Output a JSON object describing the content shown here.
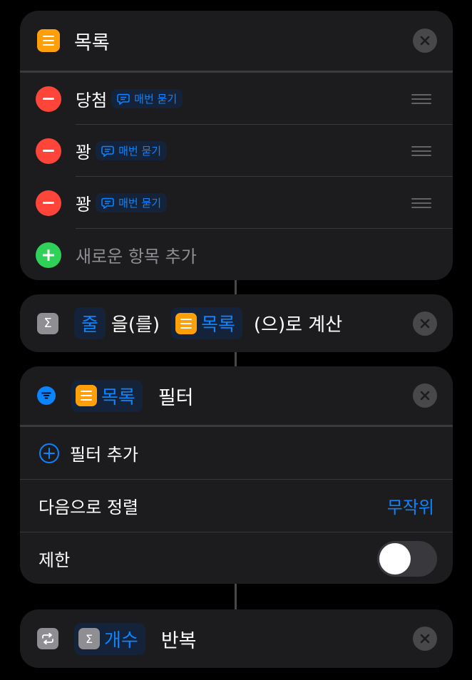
{
  "list_card": {
    "title": "목록",
    "items": [
      {
        "label": "당첨",
        "ask_label": "매번 묻기"
      },
      {
        "label": "꽝",
        "ask_label": "매번 묻기"
      },
      {
        "label": "꽝",
        "ask_label": "매번 묻기"
      }
    ],
    "add_label": "새로운 항목 추가"
  },
  "calc_card": {
    "token1": "줄",
    "text1": "을(를)",
    "token2": "목록",
    "text2": "(으)로 계산"
  },
  "filter_card": {
    "token": "목록",
    "title": "필터",
    "add_filter_label": "필터 추가",
    "sort_label": "다음으로 정렬",
    "sort_value": "무작위",
    "limit_label": "제한",
    "limit_enabled": false
  },
  "repeat_card": {
    "token": "개수",
    "title": "반복"
  },
  "icons": {
    "list": "list-icon",
    "sigma": "sigma-icon",
    "filter": "filter-icon",
    "repeat": "repeat-icon",
    "close": "close-icon",
    "ask": "speech-bubble-icon",
    "minus": "minus-icon",
    "plus": "plus-icon",
    "plus_circle": "plus-circle-icon",
    "drag": "drag-handle-icon"
  },
  "colors": {
    "accent": "#0a84ff",
    "orange": "#ff9f0a",
    "red": "#ff453a",
    "green": "#30d158",
    "card_bg": "#1c1c1e"
  }
}
